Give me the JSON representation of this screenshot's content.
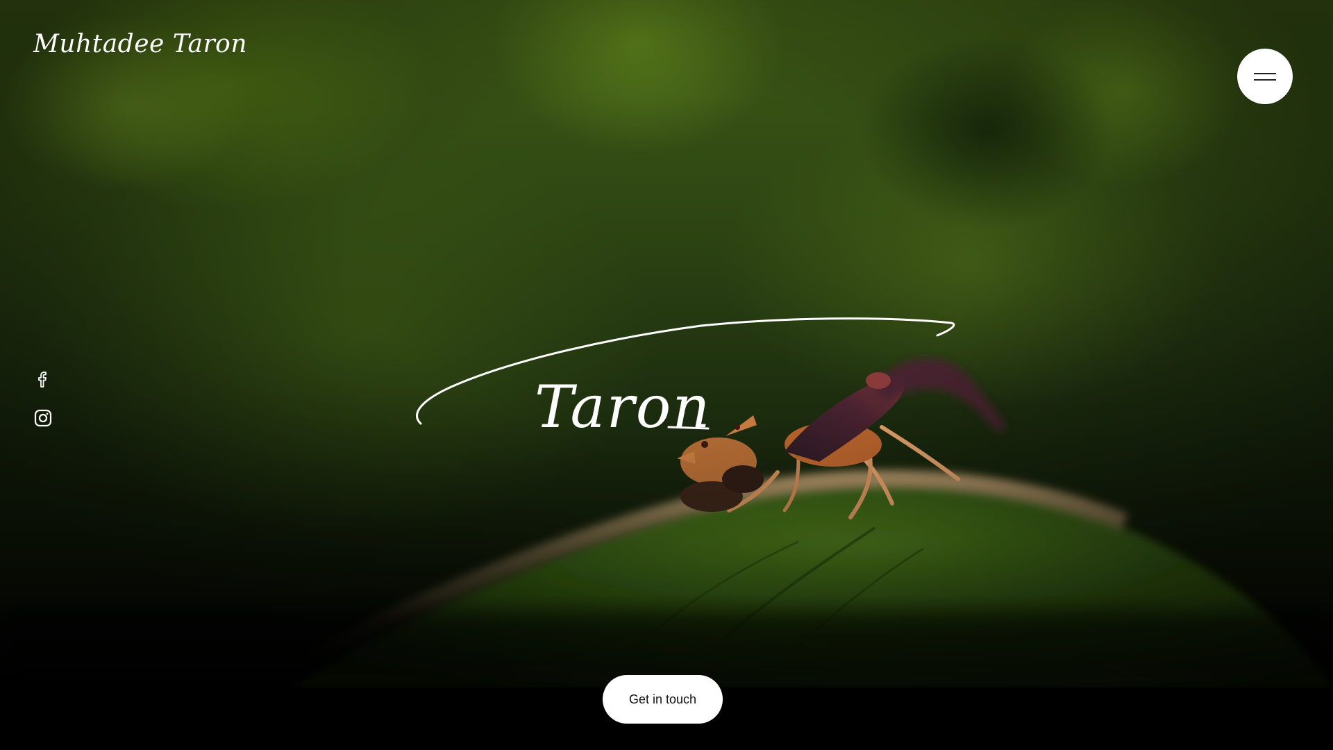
{
  "header": {
    "logo_text": "Muhtadee Taron",
    "menu_icon": "hamburger-menu-icon"
  },
  "hero": {
    "signature_text": "Taron",
    "image_subject": "macro-ant-on-leaf"
  },
  "social": {
    "items": [
      {
        "icon": "facebook-icon"
      },
      {
        "icon": "instagram-icon"
      }
    ]
  },
  "cta": {
    "label": "Get in touch"
  },
  "colors": {
    "accent": "#ffffff",
    "background": "#000000",
    "foliage": "#3e5a16"
  }
}
